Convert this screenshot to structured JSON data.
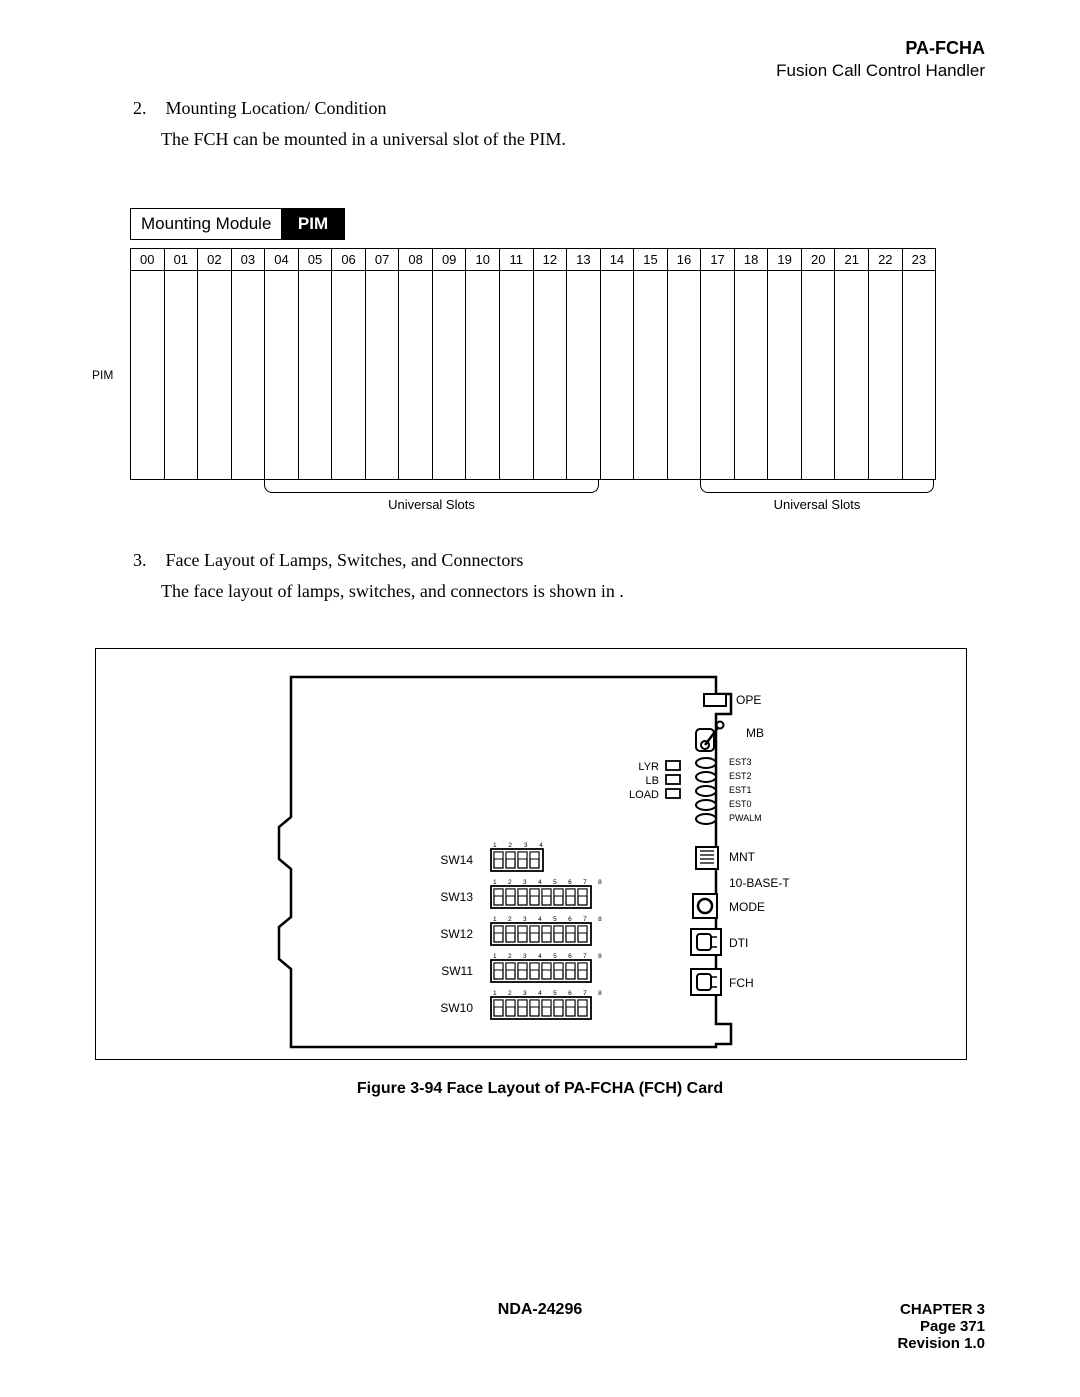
{
  "header": {
    "title": "PA-FCHA",
    "subtitle": "Fusion Call Control Handler"
  },
  "item2": {
    "num": "2.",
    "heading": "Mounting Location/ Condition",
    "body": "The FCH can be mounted in a universal slot of the PIM."
  },
  "slot_fig": {
    "mount_label": "Mounting Module",
    "pim_badge": "PIM",
    "side_label": "PIM",
    "slots": [
      "00",
      "01",
      "02",
      "03",
      "04",
      "05",
      "06",
      "07",
      "08",
      "09",
      "10",
      "11",
      "12",
      "13",
      "14",
      "15",
      "16",
      "17",
      "18",
      "19",
      "20",
      "21",
      "22",
      "23"
    ],
    "brace1": "Universal Slots",
    "brace2": "Universal Slots"
  },
  "item3": {
    "num": "3.",
    "heading": "Face Layout of Lamps, Switches, and Connectors",
    "body": "The face layout of lamps, switches, and connectors is shown in               ."
  },
  "card": {
    "labels_left_top": [
      "LYR",
      "LB",
      "LOAD"
    ],
    "labels_right_top": [
      "OPE",
      "MB",
      "EST3",
      "EST2",
      "EST1",
      "EST0",
      "PWALM"
    ],
    "labels_sw": [
      "SW14",
      "SW13",
      "SW12",
      "SW11",
      "SW10"
    ],
    "labels_right_bottom": [
      "MNT",
      "10-BASE-T",
      "MODE",
      "DTI",
      "FCH"
    ],
    "dip_nums4": "1 2 3 4",
    "dip_nums8": "1 2 3 4 5 6 7 8"
  },
  "caption": "Figure 3-94   Face Layout of PA-FCHA (FCH) Card",
  "footer": {
    "center": "NDA-24296",
    "chapter": "CHAPTER 3",
    "page": "Page 371",
    "rev": "Revision 1.0"
  }
}
